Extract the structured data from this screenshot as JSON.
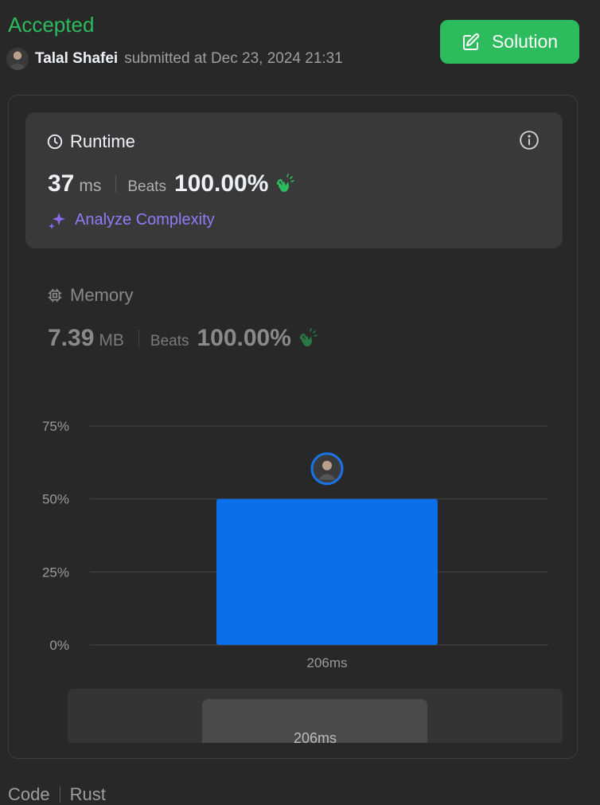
{
  "status": {
    "title": "Accepted",
    "color": "#2cbb5d"
  },
  "submission": {
    "user": "Talal Shafei",
    "text": "submitted at Dec 23, 2024 21:31"
  },
  "solution_button": {
    "label": "Solution",
    "icon": "edit-icon"
  },
  "runtime": {
    "label": "Runtime",
    "icon": "clock-icon",
    "value": "37",
    "unit": "ms",
    "beats_label": "Beats",
    "beats_value": "100.00%",
    "analyze_label": "Analyze Complexity",
    "analyze_icon": "sparkle-icon"
  },
  "memory": {
    "label": "Memory",
    "icon": "chip-icon",
    "value": "7.39",
    "unit": "MB",
    "beats_label": "Beats",
    "beats_value": "100.00%"
  },
  "chart_data": {
    "type": "bar",
    "categories": [
      "206ms"
    ],
    "values": [
      50
    ],
    "ylim": [
      0,
      75
    ],
    "yticks": [
      "0%",
      "25%",
      "50%",
      "75%"
    ],
    "ytick_values": [
      0,
      25,
      50,
      75
    ],
    "grid": true,
    "bar_color": "#0a6fe8"
  },
  "overview": {
    "label": "206ms"
  },
  "code_tabs": [
    "Code",
    "Rust"
  ]
}
